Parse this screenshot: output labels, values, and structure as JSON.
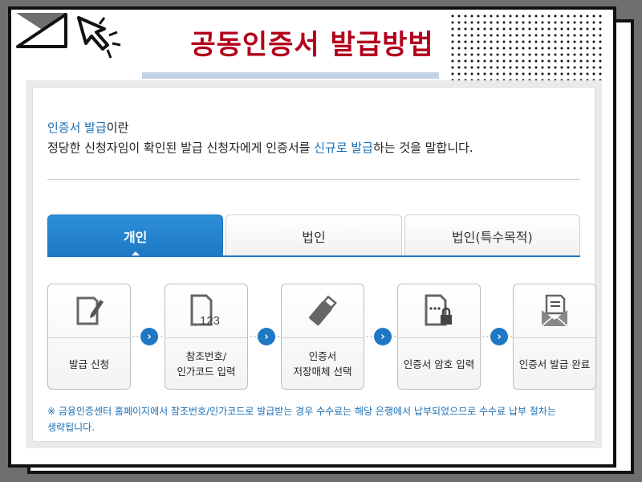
{
  "header": {
    "title": "공동인증서 발급방법"
  },
  "intro": {
    "term": "인증서 발급",
    "term_suffix": "이란",
    "desc_before": "정당한 신청자임이 확인된 발급 신청자에게 인증서를 ",
    "desc_highlight": "신규로 발급",
    "desc_after": "하는 것을 말합니다."
  },
  "tabs": [
    {
      "label": "개인",
      "active": true
    },
    {
      "label": "법인",
      "active": false
    },
    {
      "label": "법인(특수목적)",
      "active": false
    }
  ],
  "steps": [
    {
      "label": "발급 신청",
      "icon": "document-pen-icon"
    },
    {
      "label": "참조번호/\n인가코드 입력",
      "icon": "document-123-icon"
    },
    {
      "label": "인증서\n저장매체 선택",
      "icon": "usb-drive-icon"
    },
    {
      "label": "인증서 암호 입력",
      "icon": "document-lock-icon"
    },
    {
      "label": "인증서 발급 완료",
      "icon": "envelope-document-icon"
    }
  ],
  "step_icon_text": "123",
  "arrow_glyph": "›",
  "note": "※ 금융인증센터 홈페이지에서 참조번호/인가코드로 발급받는 경우 수수료는 해당 은행에서 납부되었으므로 수수료 납부 절차는\n    생략됩니다.",
  "colors": {
    "title": "#b3001b",
    "accent": "#1e78c4",
    "highlight": "#1b6fb5"
  }
}
